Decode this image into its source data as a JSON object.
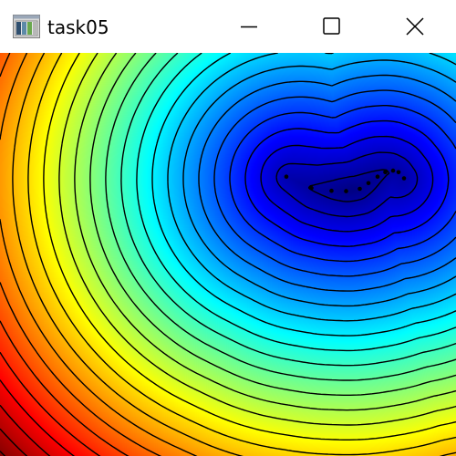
{
  "window": {
    "title": "task05",
    "icon": "app-window-icon",
    "controls": {
      "minimize_icon": "minimize-icon",
      "maximize_icon": "maximize-icon",
      "close_icon": "close-icon"
    }
  },
  "plot": {
    "colormap": [
      "#800000",
      "#ff0000",
      "#ff8000",
      "#ffff00",
      "#80ff80",
      "#00ffff",
      "#0080ff",
      "#0000ff",
      "#000080"
    ],
    "contour_color": "#000000",
    "markers": [
      [
        0.628,
        0.307
      ],
      [
        0.683,
        0.335
      ],
      [
        0.727,
        0.342
      ],
      [
        0.759,
        0.343
      ],
      [
        0.789,
        0.337
      ],
      [
        0.808,
        0.323
      ],
      [
        0.828,
        0.307
      ],
      [
        0.845,
        0.296
      ],
      [
        0.862,
        0.292
      ],
      [
        0.874,
        0.296
      ],
      [
        0.886,
        0.311
      ]
    ]
  }
}
